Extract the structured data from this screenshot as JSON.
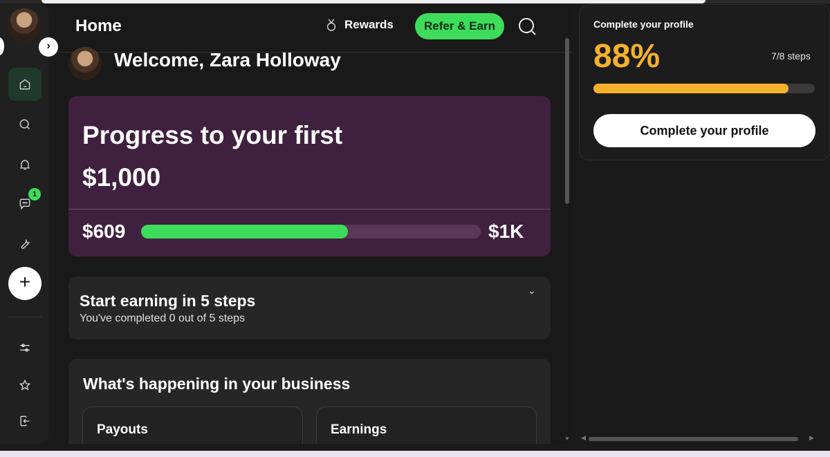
{
  "header": {
    "title": "Home",
    "rewards_label": "Rewards",
    "refer_label": "Refer & Earn"
  },
  "sidebar": {
    "collapse_icon": "chevron-right-icon",
    "items": [
      {
        "name": "home",
        "icon": "home-icon",
        "active": true
      },
      {
        "name": "search",
        "icon": "search-icon"
      },
      {
        "name": "notifications",
        "icon": "bell-icon"
      },
      {
        "name": "messages",
        "icon": "chat-icon",
        "badge": "1"
      },
      {
        "name": "tools",
        "icon": "wrench-icon"
      },
      {
        "name": "add",
        "icon": "plus-icon"
      },
      {
        "name": "settings",
        "icon": "sliders-icon"
      },
      {
        "name": "favorites",
        "icon": "star-icon"
      },
      {
        "name": "logout",
        "icon": "logout-icon"
      }
    ]
  },
  "welcome": {
    "text": "Welcome, Zara Holloway"
  },
  "progress": {
    "heading": "Progress to your first $1,000",
    "current_label": "$609",
    "goal_label": "$1K",
    "fraction": 0.609,
    "fill_color": "#3ddc5b"
  },
  "steps": {
    "title": "Start earning in 5 steps",
    "subtitle": "You've completed 0 out of 5 steps"
  },
  "business": {
    "title": "What's happening in your business",
    "cards": [
      "Payouts",
      "Earnings"
    ]
  },
  "profile": {
    "label": "Complete your profile",
    "percent_label": "88%",
    "steps_label": "7/8 steps",
    "fraction": 0.88,
    "button_label": "Complete your profile",
    "accent_color": "#f5b12c"
  }
}
